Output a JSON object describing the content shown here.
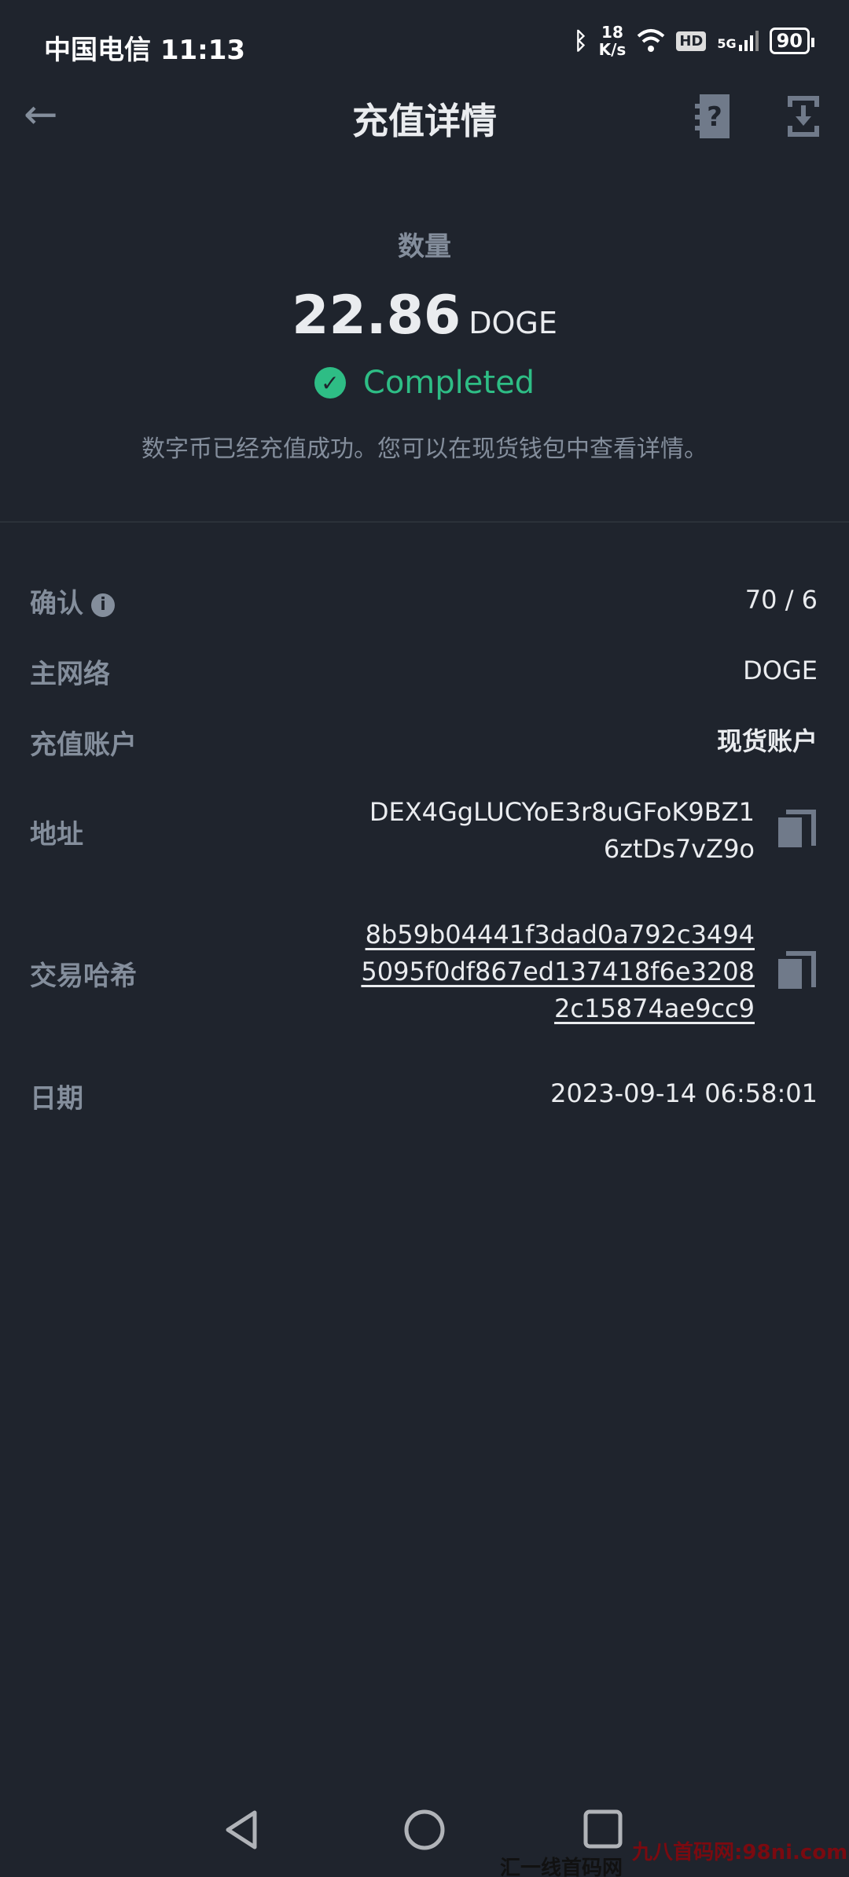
{
  "status_bar": {
    "carrier_time": "中国电信 11:13",
    "speed_value": "18",
    "speed_unit": "K/s",
    "hd": "HD",
    "network": "5G",
    "battery": "90"
  },
  "header": {
    "title": "充值详情",
    "back_icon": "arrow-left-icon",
    "help_icon": "help-doc-icon",
    "download_icon": "download-icon"
  },
  "summary": {
    "amount_label": "数量",
    "amount": "22.86",
    "unit": "DOGE",
    "status": "Completed",
    "description": "数字币已经充值成功。您可以在现货钱包中查看详情。",
    "status_color": "#2ebd85"
  },
  "details": {
    "confirm": {
      "label": "确认",
      "value": "70 / 6"
    },
    "network": {
      "label": "主网络",
      "value": "DOGE"
    },
    "account": {
      "label": "充值账户",
      "value": "现货账户"
    },
    "address": {
      "label": "地址",
      "lines": [
        "DEX4GgLUCYoE3r8uGFoK9BZ1",
        "6ztDs7vZ9o"
      ]
    },
    "txid": {
      "label": "交易哈希",
      "lines": [
        "8b59b04441f3dad0a792c3494",
        "5095f0df867ed137418f6e3208",
        "2c15874ae9cc9"
      ]
    },
    "date": {
      "label": "日期",
      "value": "2023-09-14 06:58:01"
    }
  },
  "watermarks": [
    "九八首码网:98ni.com",
    "汇一线首码网 www.huiyixian.com"
  ]
}
